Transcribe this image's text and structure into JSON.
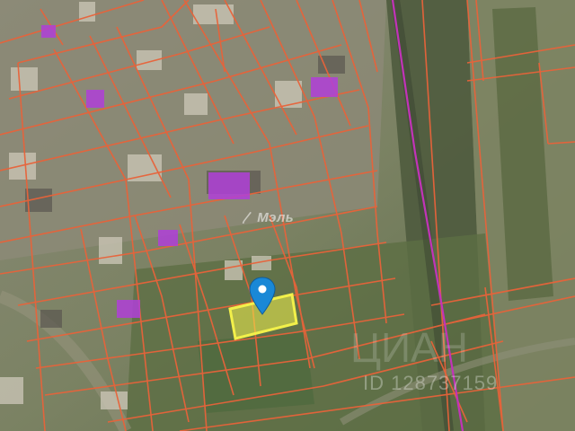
{
  "map": {
    "base_layer": "satellite",
    "overlay": "cadastral-parcels",
    "parcel_line_color": "#e8633a",
    "zoned_building_color": "#b040d8",
    "selected_parcel_color": "#f2f04a",
    "boundary_line_color": "#c233b8",
    "marker_color": "#1a88d6",
    "marker_icon": "map-pin-icon"
  },
  "watermarks": {
    "logo_text": "Мэль",
    "brand_text": "ЦИАН",
    "listing_id": "ID 128737159"
  }
}
